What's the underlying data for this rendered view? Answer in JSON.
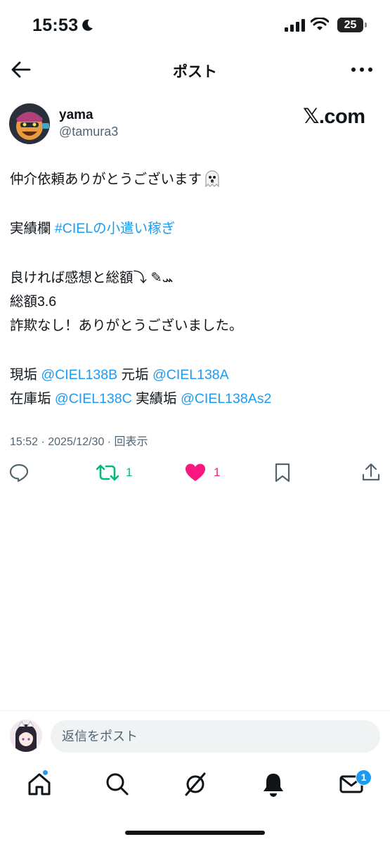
{
  "status_bar": {
    "time": "15:53",
    "battery": "25"
  },
  "header": {
    "title": "ポスト"
  },
  "author": {
    "name": "yama",
    "handle": "@tamura3"
  },
  "watermark": "𝕏.com",
  "post": {
    "line1": "仲介依頼ありがとうございます",
    "line2_prefix": "実績欄 ",
    "hashtag": "#CIELの小遣い稼ぎ",
    "line3": "良ければ感想と総額⤵︎ ✎ܚ",
    "line4": "総額3.6",
    "line5": "詐欺なし！ありがとうございました。",
    "line6_label1": "現垢 ",
    "mention1": "@CIEL138B",
    "line6_label2": " 元垢 ",
    "mention2": "@CIEL138A",
    "line7_label1": "在庫垢 ",
    "mention3": "@CIEL138C",
    "line7_label2": " 実績垢 ",
    "mention4": "@CIEL138As2"
  },
  "meta": "15:52 · 2025/12/30 · 回表示",
  "actions": {
    "retweet_count": "1",
    "like_count": "1"
  },
  "reply": {
    "placeholder": "返信をポスト"
  },
  "tabs": {
    "messages_badge": "1"
  },
  "colors": {
    "link": "#1d9bf0",
    "retweet": "#00ba7c",
    "like": "#f91880",
    "text": "#0f1419",
    "secondary": "#536471"
  },
  "icons": [
    "back-arrow-icon",
    "more-icon",
    "reply-icon",
    "retweet-icon",
    "like-icon",
    "bookmark-icon",
    "share-icon",
    "home-icon",
    "search-icon",
    "grok-icon",
    "bell-icon",
    "mail-icon"
  ]
}
